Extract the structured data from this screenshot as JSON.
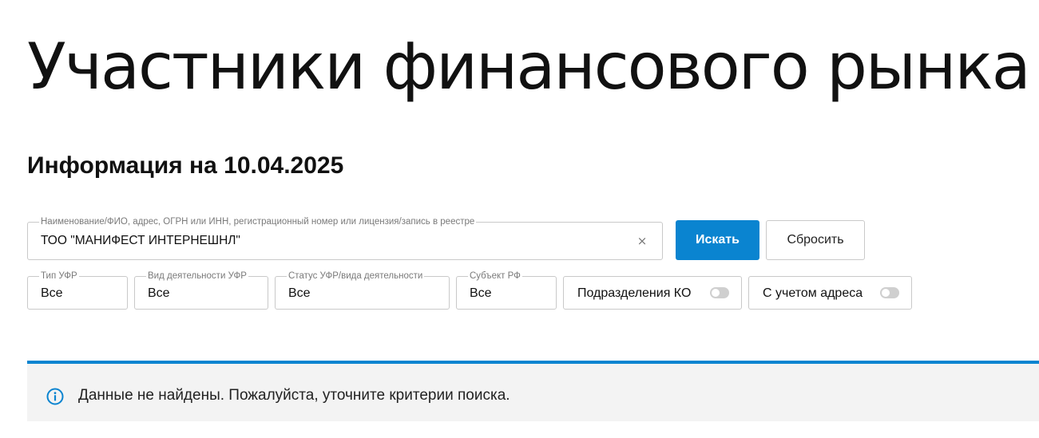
{
  "page": {
    "title": "Участники финансового рынка",
    "info_date": "Информация на 10.04.2025"
  },
  "search": {
    "legend": "Наименование/ФИО, адрес, ОГРН или ИНН, регистрационный номер или лицензия/запись в реестре",
    "value": "ТОО \"МАНИФЕСТ ИНТЕРНЕШНЛ\"",
    "clear_icon": "close-icon",
    "clear_glyph": "×",
    "search_label": "Искать",
    "reset_label": "Сбросить"
  },
  "filters": {
    "type": {
      "legend": "Тип УФР",
      "value": "Все"
    },
    "activity": {
      "legend": "Вид деятельности УФР",
      "value": "Все"
    },
    "status": {
      "legend": "Статус УФР/вида деятельности",
      "value": "Все"
    },
    "region": {
      "legend": "Субъект РФ",
      "value": "Все"
    }
  },
  "toggles": {
    "ko_divisions": {
      "label": "Подразделения КО",
      "on": false
    },
    "with_address": {
      "label": "С учетом адреса",
      "on": false
    }
  },
  "notice": {
    "icon": "info-icon",
    "text": "Данные не найдены. Пожалуйста, уточните критерии поиска."
  },
  "colors": {
    "accent": "#0a84d0",
    "notice_bg": "#f3f3f3",
    "border": "#c9c9c9",
    "switch_off": "#cfcfcf"
  }
}
